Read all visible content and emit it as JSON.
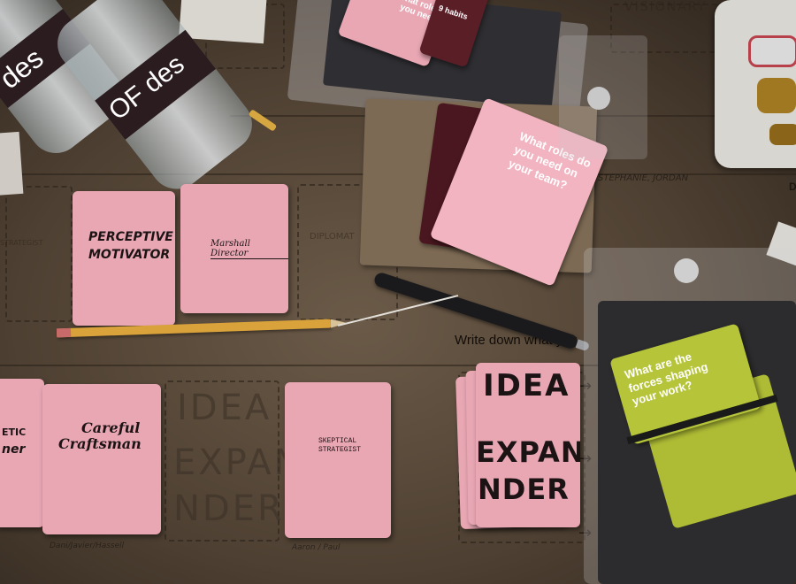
{
  "cards": {
    "perceptive_line1": "PERCEPTIVE",
    "perceptive_line2": "MOTIVATOR",
    "marshall": "Marshall Director",
    "careful_line1": "Careful",
    "careful_line2": "Craftsman",
    "skeptical_line1": "SKEPTICAL",
    "skeptical_line2": "STRATEGIST",
    "idea_line1": "IDEA",
    "idea_line2": "EXPAN",
    "idea_line3": "NDER",
    "partial_left": "ETIC",
    "partial_left2": "ner",
    "roles_question": "What roles do you need on your team?",
    "roles_partial": "What roles you need",
    "habits_partial": "9 habits",
    "forces_question": "What are the forces shaping your work?"
  },
  "board": {
    "instruction": "Write down what you",
    "header_visionary": "VISIONARY",
    "names_top": "STEPHANIE, JORDAN",
    "diplomat_partial": "DIPLOMAT",
    "sig_bottom_left": "Dani/Javier/Hassell",
    "sig_bottom_mid": "Aaron / Paul",
    "top_right_letter": "D",
    "left_slot_partial": "STRATEGIST"
  },
  "bottles": {
    "label_text": "des",
    "label_text2": "OF des"
  },
  "colors": {
    "pink_card": "#e9a7b4",
    "green_card": "#b6c43a",
    "kraft": "#6b5a48"
  }
}
